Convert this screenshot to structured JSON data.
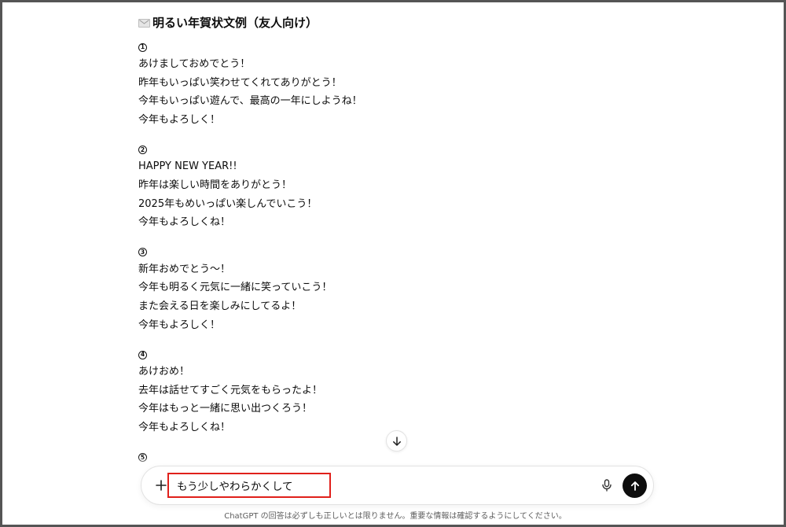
{
  "chat": {
    "heading": "明るい年賀状文例（友人向け）",
    "heading_icon": "envelope-icon",
    "examples": [
      {
        "number": "1",
        "lines": [
          "あけましておめでとう！",
          "昨年もいっぱい笑わせてくれてありがとう！",
          "今年もいっぱい遊んで、最高の一年にしようね！",
          "今年もよろしく！"
        ]
      },
      {
        "number": "2",
        "lines": [
          "HAPPY NEW YEAR!!",
          "昨年は楽しい時間をありがとう！",
          "2025年もめいっぱい楽しんでいこう！",
          "今年もよろしくね！"
        ]
      },
      {
        "number": "3",
        "lines": [
          "新年おめでとう～！",
          "今年も明るく元気に一緒に笑っていこう！",
          "また会える日を楽しみにしてるよ！",
          "今年もよろしく！"
        ]
      },
      {
        "number": "4",
        "lines": [
          "あけおめ！",
          "去年は話せてすごく元気をもらったよ！",
          "今年はもっと一緒に思い出つくろう！",
          "今年もよろしくね！"
        ]
      },
      {
        "number": "5",
        "lines": []
      }
    ]
  },
  "scroll_button_icon": "arrow-down-icon",
  "composer": {
    "plus_icon": "plus-icon",
    "input_value": "もう少しやわらかくして",
    "mic_icon": "microphone-icon",
    "send_icon": "arrow-up-icon"
  },
  "disclaimer": "ChatGPT の回答は必ずしも正しいとは限りません。重要な情報は確認するようにしてください。",
  "colors": {
    "highlight_border": "#e0201b",
    "send_button": "#0d0d0d",
    "frame_border": "#555555"
  }
}
